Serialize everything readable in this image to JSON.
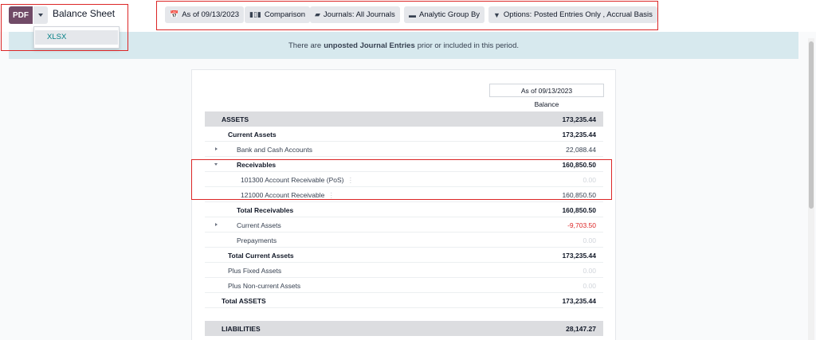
{
  "toolbar": {
    "pdf_label": "PDF",
    "title": "Balance Sheet",
    "export_options": [
      "XLSX"
    ]
  },
  "filters": [
    {
      "icon": "calendar-icon",
      "label": "As of 09/13/2023"
    },
    {
      "icon": "bar-chart-icon",
      "label": "Comparison"
    },
    {
      "icon": "book-icon",
      "label": "Journals: All Journals"
    },
    {
      "icon": "folder-open-icon",
      "label": "Analytic Group By"
    },
    {
      "icon": "filter-icon",
      "label": "Options: Posted Entries Only , Accrual Basis"
    }
  ],
  "banner": {
    "before": "There are",
    "emphasis": "unposted Journal Entries",
    "after": "prior or included in this period."
  },
  "report": {
    "column_header": "As of 09/13/2023",
    "column_sub": "Balance",
    "rows": [
      {
        "label": "ASSETS",
        "value": "173,235.44"
      },
      {
        "label": "Current Assets",
        "value": "173,235.44"
      },
      {
        "label": "Bank and Cash Accounts",
        "value": "22,088.44"
      },
      {
        "label": "Receivables",
        "value": "160,850.50"
      },
      {
        "label": "101300 Account Receivable (PoS)",
        "value": "0.00"
      },
      {
        "label": "121000 Account Receivable",
        "value": "160,850.50"
      },
      {
        "label": "Total Receivables",
        "value": "160,850.50"
      },
      {
        "label": "Current Assets",
        "value": "-9,703.50"
      },
      {
        "label": "Prepayments",
        "value": "0.00"
      },
      {
        "label": "Total Current Assets",
        "value": "173,235.44"
      },
      {
        "label": "Plus Fixed Assets",
        "value": "0.00"
      },
      {
        "label": "Plus Non-current Assets",
        "value": "0.00"
      },
      {
        "label": "Total ASSETS",
        "value": "173,235.44"
      },
      {
        "label": "LIABILITIES",
        "value": "28,147.27"
      }
    ]
  },
  "colors": {
    "brand": "#714b67",
    "highlight": "#dc2626",
    "banner_bg": "#d7e9ee",
    "link": "#017e84"
  }
}
